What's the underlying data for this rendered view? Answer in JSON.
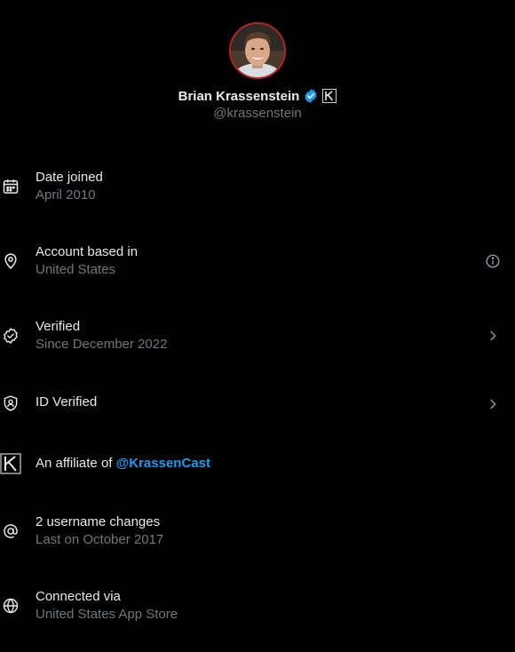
{
  "profile": {
    "name": "Brian Krassenstein",
    "handle": "@krassenstein",
    "verified_badge_color": "#1d9bf0",
    "affiliate_badge_icon": "k-logo-icon"
  },
  "rows": [
    {
      "icon": "calendar-icon",
      "primary": "Date joined",
      "secondary": "April 2010",
      "trailing": null
    },
    {
      "icon": "location-pin-icon",
      "primary": "Account based in",
      "secondary": "United States",
      "trailing": "info-icon"
    },
    {
      "icon": "verified-check-icon",
      "primary": "Verified",
      "secondary": "Since December 2022",
      "trailing": "chevron-right-icon"
    },
    {
      "icon": "id-shield-icon",
      "primary": "ID Verified",
      "secondary": "",
      "trailing": "chevron-right-icon"
    },
    {
      "icon": "k-logo-icon",
      "primary_prefix": "An affiliate of ",
      "primary_link": "@KrassenCast",
      "trailing": null
    },
    {
      "icon": "at-sign-icon",
      "primary": "2 username changes",
      "secondary": "Last on October 2017",
      "trailing": null
    },
    {
      "icon": "globe-icon",
      "primary": "Connected via",
      "secondary": "United States App Store",
      "trailing": null
    }
  ],
  "colors": {
    "background": "#000000",
    "primary_text": "#e7e9ea",
    "secondary_text": "#71767b",
    "link": "#1d9bf0",
    "avatar_border": "#b3261e"
  }
}
